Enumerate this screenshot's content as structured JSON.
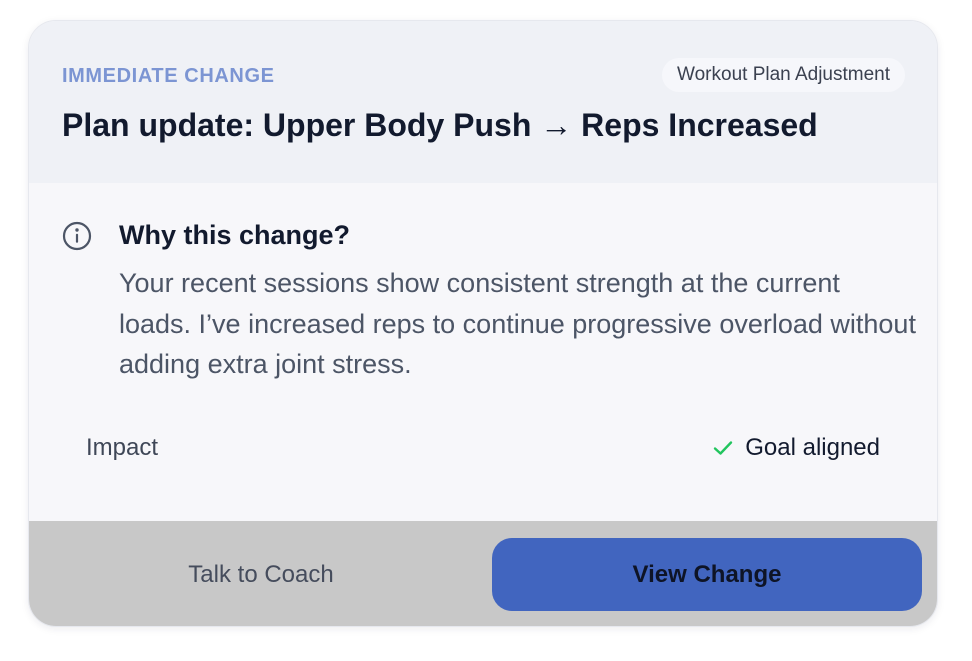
{
  "card": {
    "eyebrow": "IMMEDIATE CHANGE",
    "tag": "Workout Plan Adjustment",
    "title": "Plan update: Upper Body Push → Reps Increased"
  },
  "reason": {
    "icon": "info-icon",
    "title": "Why this change?",
    "body": "Your recent sessions show consistent strength at the current loads. I’ve increased reps to continue progressive overload without adding extra joint stress."
  },
  "impact": {
    "label": "Impact",
    "icon": "check-icon",
    "value": "Goal aligned"
  },
  "actions": {
    "secondary_label": "Talk to Coach",
    "primary_label": "View Change"
  },
  "colors": {
    "accent": "#4165bf",
    "eyebrow": "#7c95d3",
    "success": "#22c55e",
    "footer_bg": "#c8c8c8"
  }
}
